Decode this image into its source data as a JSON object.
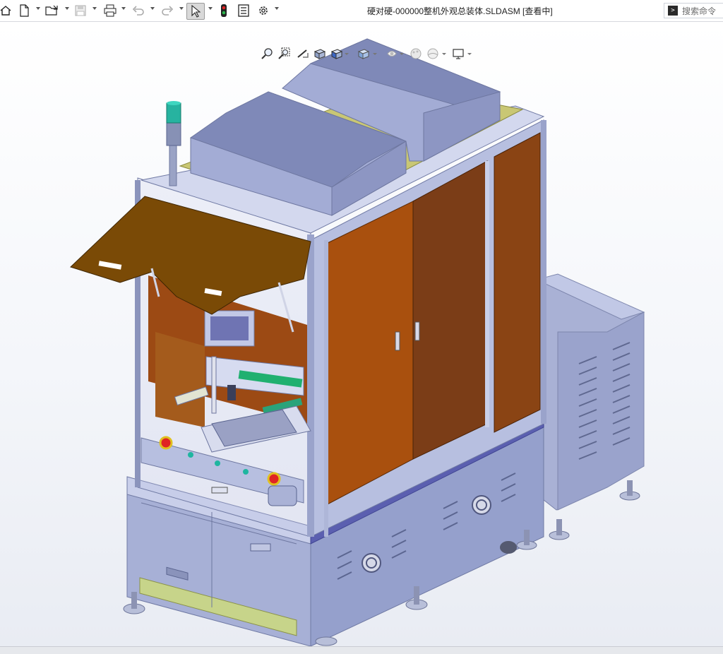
{
  "window": {
    "title": "硬对硬-000000整机外观总装体.SLDASM [查看中]"
  },
  "toolbar": {
    "items": [
      "home-icon",
      "new-document-icon",
      "open-icon",
      "save-icon",
      "print-icon",
      "undo-icon",
      "redo-icon",
      "select-icon",
      "rebuild-icon",
      "file-properties-icon",
      "options-icon"
    ]
  },
  "search": {
    "placeholder": "搜索命令"
  },
  "heads_up_toolbar": {
    "items": [
      "zoom-to-fit-icon",
      "zoom-to-area-icon",
      "previous-view-icon",
      "section-view-icon",
      "view-orientation-icon",
      "display-style-icon",
      "hide-show-items-icon",
      "edit-appearance-icon",
      "apply-scene-icon",
      "view-settings-icon"
    ]
  },
  "colors": {
    "frame": "#b3bcd8",
    "panel_orange": "#9a4a10",
    "door_brown": "#7a3a16",
    "top_cover": "#8c97c4",
    "yellow_plate": "#c7c67a",
    "cabinet": "#9ba6cf",
    "lid": "#7a4a06"
  }
}
